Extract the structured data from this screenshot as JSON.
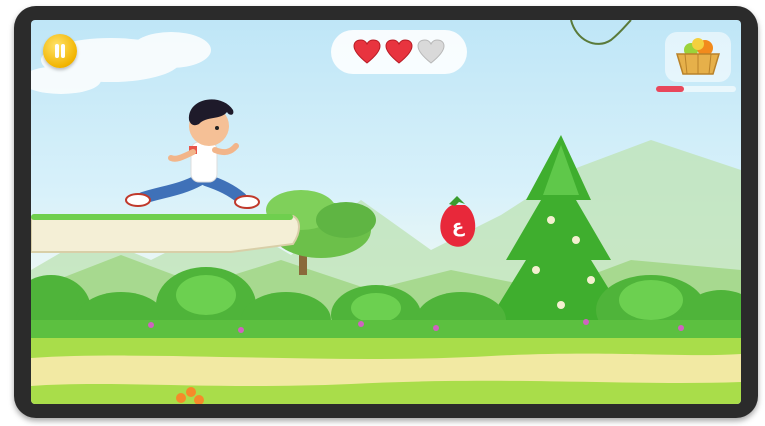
{
  "game": {
    "pause_icon": "pause-icon",
    "lives": {
      "total": 3,
      "filled": 2,
      "full_color": "#e8343f",
      "empty_color": "#d9d9d9"
    },
    "basket_icon": "fruit-basket-icon",
    "progress": {
      "fraction": 0.35,
      "color": "#e8475b"
    },
    "collectible": {
      "letter": "ع",
      "fruit_icon": "strawberry-icon",
      "color": "#e8283a"
    },
    "player": {
      "character": "running-boy"
    }
  }
}
